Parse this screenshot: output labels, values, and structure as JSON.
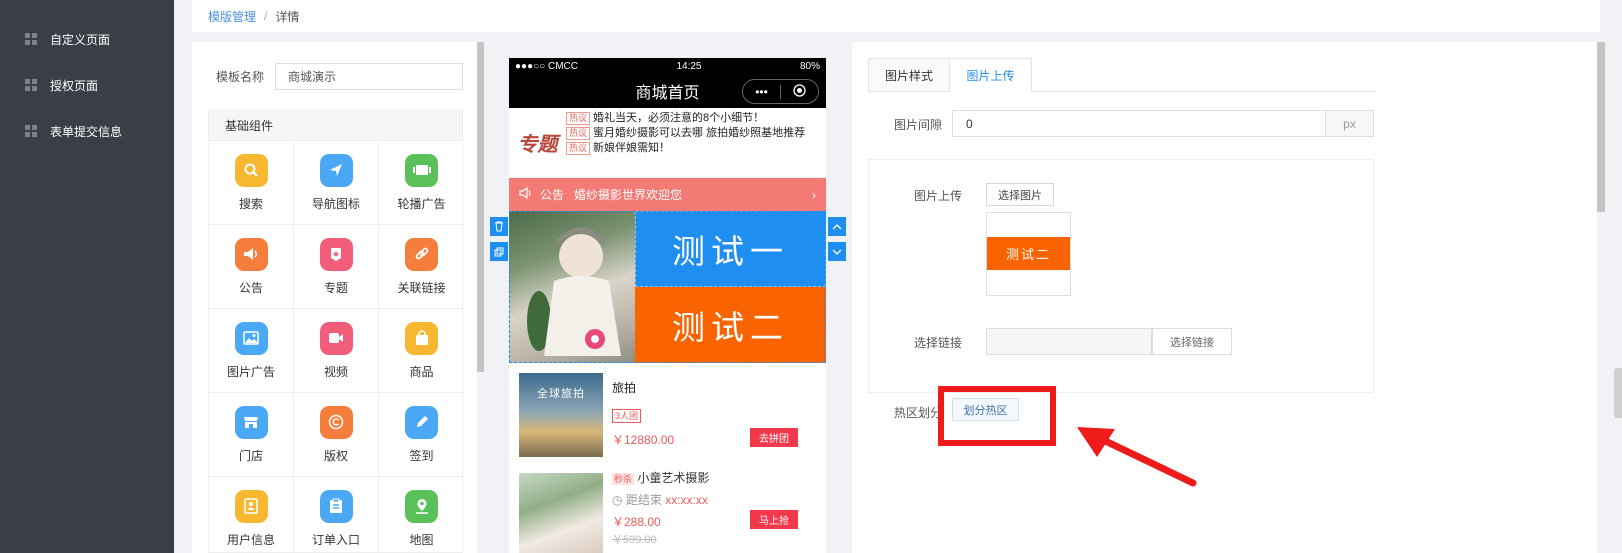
{
  "sidebar": {
    "items": [
      {
        "label": "自定义页面"
      },
      {
        "label": "授权页面"
      },
      {
        "label": "表单提交信息"
      }
    ]
  },
  "breadcrumb": {
    "link": "模版管理",
    "separator": "/",
    "current": "详情"
  },
  "template_form": {
    "name_label": "模板名称",
    "name_value": "商城演示"
  },
  "components": {
    "section_title": "基础组件",
    "items": [
      {
        "label": "搜索",
        "icon": "search-icon",
        "color": "#f7b730"
      },
      {
        "label": "导航图标",
        "icon": "navigation-icon",
        "color": "#4aa8f5"
      },
      {
        "label": "轮播广告",
        "icon": "carousel-icon",
        "color": "#5ac05a"
      },
      {
        "label": "公告",
        "icon": "speaker-icon",
        "color": "#f57e3d"
      },
      {
        "label": "专题",
        "icon": "topic-icon",
        "color": "#f25d7a"
      },
      {
        "label": "关联链接",
        "icon": "link-icon",
        "color": "#f57e3d"
      },
      {
        "label": "图片广告",
        "icon": "image-icon",
        "color": "#4aa8f5"
      },
      {
        "label": "视频",
        "icon": "video-icon",
        "color": "#f25d7a"
      },
      {
        "label": "商品",
        "icon": "bag-icon",
        "color": "#f7b730"
      },
      {
        "label": "门店",
        "icon": "store-icon",
        "color": "#4aa8f5"
      },
      {
        "label": "版权",
        "icon": "copyright-icon",
        "color": "#f57e3d"
      },
      {
        "label": "签到",
        "icon": "pencil-icon",
        "color": "#4aa8f5"
      },
      {
        "label": "用户信息",
        "icon": "user-card-icon",
        "color": "#f7b730"
      },
      {
        "label": "订单入口",
        "icon": "clipboard-icon",
        "color": "#4aa8f5"
      },
      {
        "label": "地图",
        "icon": "map-pin-icon",
        "color": "#5ac05a"
      }
    ]
  },
  "phone": {
    "carrier": "●●●○○ CMCC",
    "time": "14:25",
    "battery": "80%",
    "title": "商城首页",
    "capsule_more": "•••",
    "topic_logo": "专题",
    "topic_tag": "热议",
    "topic_lines": [
      "婚礼当天，必须注意的8个小细节！",
      "蜜月婚纱摄影可以去哪 旅拍婚纱照基地推荐",
      "新娘伴娘需知！"
    ],
    "notice_label": "公告",
    "notice_text": "婚纱摄影世界欢迎您",
    "notice_arrow": "›",
    "banner_text_1": "测试一",
    "banner_text_2": "测试二",
    "products": [
      {
        "image_caption": "全球旅拍",
        "title": "旅拍",
        "badge": "3人团",
        "price": "￥12880.00",
        "button": "去拼团"
      },
      {
        "seckill_tag": "秒杀",
        "title": "小童艺术摄影",
        "countdown_label": "距结束",
        "countdown": "xx:xx:xx",
        "price": "￥288.00",
        "old_price": "￥599.00",
        "button": "马上抢"
      }
    ],
    "action_icons": [
      "trash-icon",
      "copy-icon",
      "arrow-up-icon",
      "arrow-down-icon"
    ]
  },
  "settings": {
    "tabs": [
      "图片样式",
      "图片上传"
    ],
    "active_tab": "图片上传",
    "gap_label": "图片间隙",
    "gap_value": "0",
    "gap_unit": "px",
    "upload_label": "图片上传",
    "upload_button": "选择图片",
    "thumb_text": "测试二",
    "link_label": "选择链接",
    "link_button": "选择链接",
    "hotspot_label": "热区划分",
    "hotspot_button": "划分热区"
  },
  "annotation": {
    "highlight_color": "#ee1b1b"
  }
}
